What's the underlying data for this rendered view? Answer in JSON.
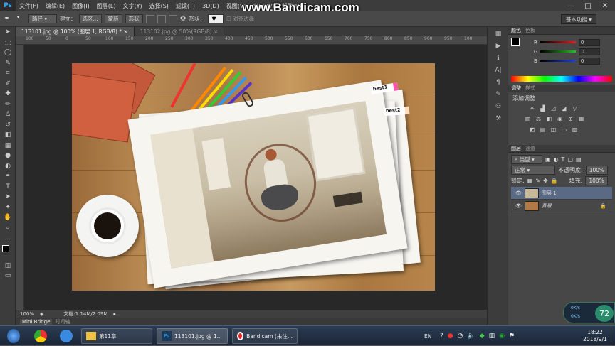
{
  "menubar": {
    "logo": "Ps",
    "items": [
      "文件(F)",
      "编辑(E)",
      "图像(I)",
      "图层(L)",
      "文字(Y)",
      "选择(S)",
      "滤镜(T)",
      "3D(D)",
      "视图(V)",
      "窗口(W)",
      "帮助(H)"
    ],
    "window_controls": [
      "—",
      "□",
      "✕"
    ]
  },
  "watermark": "www.Bandicam.com",
  "options": {
    "mode": "路径",
    "build_label": "建立：",
    "selection_btn": "选区...",
    "mask_btn": "蒙版",
    "shape_btn": "形状",
    "shape_label": "形状：",
    "align_edges": "对齐边缘",
    "workspace": "基本功能"
  },
  "tabs": [
    {
      "label": "113101.jpg @ 100% (图层 1, RGB/8) *",
      "close": "×"
    },
    {
      "label": "113102.jpg @ 50%(RGB/8)",
      "close": "×"
    }
  ],
  "ruler": {
    "ticks": [
      "100",
      "50",
      "0",
      "50",
      "100",
      "150",
      "200",
      "250",
      "300",
      "350",
      "400",
      "450",
      "500",
      "550",
      "600",
      "650",
      "700",
      "750",
      "800",
      "850",
      "900",
      "950",
      "100"
    ]
  },
  "canvas": {
    "labels": [
      "best1",
      "best2"
    ]
  },
  "status": {
    "zoom": "100%",
    "doc": "文档:1.14M/2.09M"
  },
  "bottom_tabs": [
    "Mini Bridge",
    "时间轴"
  ],
  "color_panel": {
    "tabs": [
      "颜色",
      "色板"
    ],
    "channels": [
      {
        "name": "R",
        "value": "0",
        "color": "#e02020"
      },
      {
        "name": "G",
        "value": "0",
        "color": "#20c020"
      },
      {
        "name": "B",
        "value": "0",
        "color": "#2040e0"
      }
    ]
  },
  "adjust_panel": {
    "tabs": [
      "调整",
      "样式"
    ],
    "title": "添加调整"
  },
  "layers_panel": {
    "tabs": [
      "图层",
      "通道"
    ],
    "filter": "类型",
    "blend": "正常",
    "opacity_label": "不透明度:",
    "opacity": "100%",
    "lock_label": "锁定:",
    "fill_label": "填充:",
    "fill": "100%",
    "layers": [
      {
        "name": "图层 1",
        "selected": true
      },
      {
        "name": "背景",
        "selected": false,
        "italic": true
      }
    ]
  },
  "perf": {
    "value": "72",
    "up": "0K/s",
    "down": "0K/s"
  },
  "taskbar": {
    "tasks": [
      "第11章",
      "113101.jpg @ 1...",
      "Bandicam (未注..."
    ],
    "lang": "EN",
    "time": "18:22",
    "date": "2018/9/1"
  }
}
